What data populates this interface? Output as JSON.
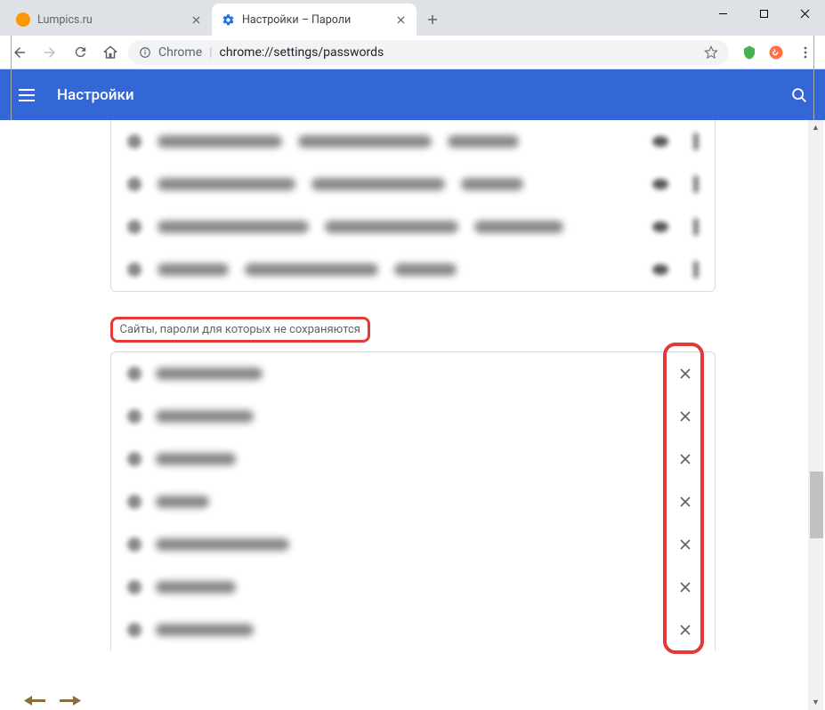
{
  "window": {
    "tabs": [
      {
        "title": "Lumpics.ru",
        "active": false
      },
      {
        "title": "Настройки – Пароли",
        "active": true
      }
    ]
  },
  "addressbar": {
    "chrome_label": "Chrome",
    "url": "chrome://settings/passwords"
  },
  "settings_header": {
    "title": "Настройки"
  },
  "sections": {
    "never_save_title": "Сайты, пароли для которых не сохраняются"
  },
  "saved_passwords_count": 4,
  "never_save_sites_count": 7,
  "icons": {
    "gear_color": "#1a73e8"
  }
}
